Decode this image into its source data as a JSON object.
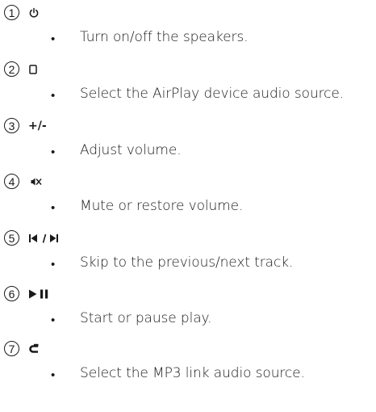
{
  "items": [
    {
      "number": "1",
      "symbol": "",
      "icon": "power-icon",
      "description": "Turn on/off the speakers."
    },
    {
      "number": "2",
      "symbol": "",
      "icon": "device-icon",
      "description": "Select the AirPlay device audio source."
    },
    {
      "number": "3",
      "symbol": "+/-",
      "icon": "",
      "description": "Adjust volume."
    },
    {
      "number": "4",
      "symbol": "",
      "icon": "mute-icon",
      "description": "Mute or restore volume."
    },
    {
      "number": "5",
      "symbol": "",
      "icon": "skip-icon",
      "description": "Skip to the previous/next track."
    },
    {
      "number": "6",
      "symbol": "",
      "icon": "play-pause-icon",
      "description": "Start or pause play."
    },
    {
      "number": "7",
      "symbol": "",
      "icon": "mp3-link-icon",
      "description": "Select the MP3 link audio source."
    }
  ],
  "bullet_char": "•"
}
